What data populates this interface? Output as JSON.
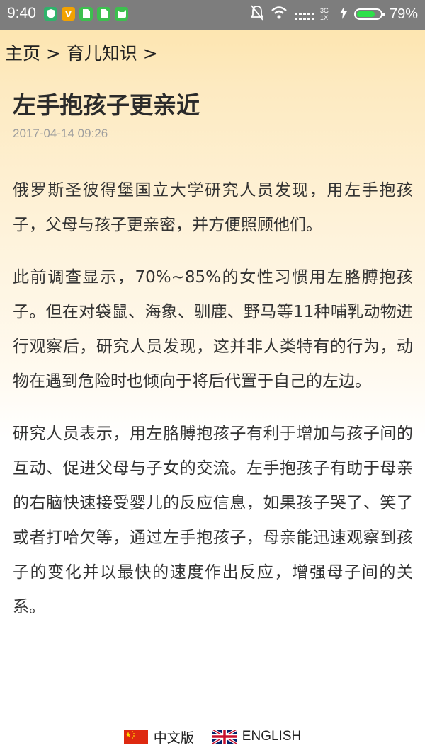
{
  "status_bar": {
    "time": "9:40",
    "battery_percent": "79%",
    "network": "3G",
    "network_sub": "1X",
    "battery_level": 0.79,
    "app_icons": [
      "shield-icon",
      "v-app-icon",
      "sim-icon",
      "sim-icon",
      "cat-app-icon"
    ],
    "indicator_icons": [
      "mute-icon",
      "wifi-icon",
      "signal-icon",
      "charging-icon",
      "battery-icon"
    ]
  },
  "breadcrumb": "主页 > 育儿知识 >",
  "article": {
    "title": "左手抱孩子更亲近",
    "date": "2017-04-14 09:26",
    "paragraphs": [
      "俄罗斯圣彼得堡国立大学研究人员发现，用左手抱孩子，父母与孩子更亲密，并方便照顾他们。",
      "此前调查显示，70%~85%的女性习惯用左胳膊抱孩子。但在对袋鼠、海象、驯鹿、野马等11种哺乳动物进行观察后，研究人员发现，这并非人类特有的行为，动物在遇到危险时也倾向于将后代置于自己的左边。",
      "研究人员表示，用左胳膊抱孩子有利于增加与孩子间的互动、促进父母与子女的交流。左手抱孩子有助于母亲的右脑快速接受婴儿的反应信息，如果孩子哭了、笑了或者打哈欠等，通过左手抱孩子，母亲能迅速观察到孩子的变化并以最快的速度作出反应，增强母子间的关系。"
    ]
  },
  "footer": {
    "chinese_label": "中文版",
    "english_label": "ENGLISH",
    "chinese_flag": "china-flag-icon",
    "english_flag": "uk-flag-icon"
  },
  "colors": {
    "status_bar_bg": "#7d7d7d",
    "header_gradient_top": "#fde3a8",
    "text": "#333333",
    "date": "#9e9e9e",
    "battery_fill": "#2ee04a"
  }
}
